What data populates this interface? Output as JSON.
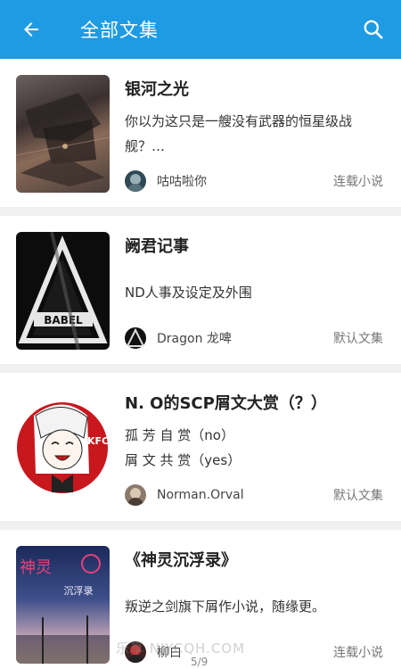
{
  "appbar": {
    "title": "全部文集"
  },
  "books": [
    {
      "title": "银河之光",
      "desc": "你以为这只是一艘没有武器的恒星级战舰？…",
      "author": "咕咕啦你",
      "category": "连载小说"
    },
    {
      "title": "阙君记事",
      "desc": "ND人事及设定及外围",
      "author": "Dragon 龙啤",
      "category": "默认文集"
    },
    {
      "title": "N. O的SCP屑文大赏（？）",
      "desc_lines": [
        "孤 芳 自 赏（no）",
        "屑 文 共 赏（yes）"
      ],
      "author": "Norman.Orval",
      "category": "默认文集"
    },
    {
      "title": "《神灵沉浮录》",
      "desc": "叛逆之剑旗下屑作小说，随缘更。",
      "author": "柳白",
      "category": "连载小说"
    }
  ],
  "cover_text": {
    "babel": "BABEL",
    "kfc": "KFC",
    "novel_big": "神灵",
    "novel_small": "沉浮录"
  },
  "watermark": "乐享 NJYCQH.COM",
  "pager": "5/9",
  "colors": {
    "appbar": "#1e9be3",
    "divider": "#f0f0f0"
  }
}
